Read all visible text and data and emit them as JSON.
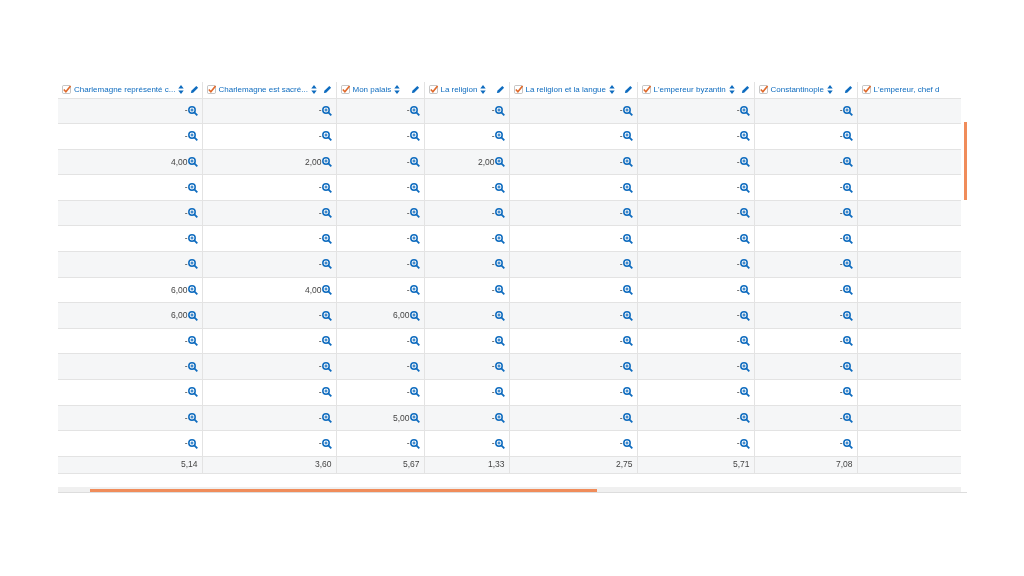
{
  "table": {
    "columns": [
      {
        "label": "Charlemagne représenté c...",
        "checked": true
      },
      {
        "label": "Charlemagne est sacré...",
        "checked": true
      },
      {
        "label": "Mon palais",
        "checked": true
      },
      {
        "label": "La religion",
        "checked": true
      },
      {
        "label": "La religion et la langue",
        "checked": true
      },
      {
        "label": "L'empereur byzantin",
        "checked": true
      },
      {
        "label": "Constantinople",
        "checked": true
      },
      {
        "label": "L'empereur, chef d",
        "checked": true
      }
    ],
    "rows": [
      [
        "-",
        "-",
        "-",
        "-",
        "-",
        "-",
        "-"
      ],
      [
        "-",
        "-",
        "-",
        "-",
        "-",
        "-",
        "-"
      ],
      [
        "4,00",
        "2,00",
        "-",
        "2,00",
        "-",
        "-",
        "-"
      ],
      [
        "-",
        "-",
        "-",
        "-",
        "-",
        "-",
        "-"
      ],
      [
        "-",
        "-",
        "-",
        "-",
        "-",
        "-",
        "-"
      ],
      [
        "-",
        "-",
        "-",
        "-",
        "-",
        "-",
        "-"
      ],
      [
        "-",
        "-",
        "-",
        "-",
        "-",
        "-",
        "-"
      ],
      [
        "6,00",
        "4,00",
        "-",
        "-",
        "-",
        "-",
        "-"
      ],
      [
        "6,00",
        "-",
        "6,00",
        "-",
        "-",
        "-",
        "-"
      ],
      [
        "-",
        "-",
        "-",
        "-",
        "-",
        "-",
        "-"
      ],
      [
        "-",
        "-",
        "-",
        "-",
        "-",
        "-",
        "-"
      ],
      [
        "-",
        "-",
        "-",
        "-",
        "-",
        "-",
        "-"
      ],
      [
        "-",
        "-",
        "5,00",
        "-",
        "-",
        "-",
        "-"
      ],
      [
        "-",
        "-",
        "-",
        "-",
        "-",
        "-",
        "-"
      ]
    ],
    "averages": [
      "5,14",
      "3,60",
      "5,67",
      "1,33",
      "2,75",
      "5,71",
      "7,08"
    ]
  }
}
